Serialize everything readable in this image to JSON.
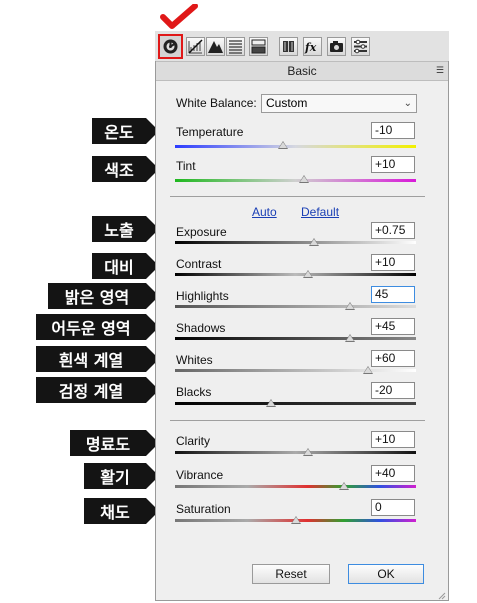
{
  "callouts": {
    "temperature": "온도",
    "tint": "색조",
    "exposure": "노출",
    "contrast": "대비",
    "highlights": "밝은 영역",
    "shadows": "어두운 영역",
    "whites": "흰색 계열",
    "blacks": "검정 계열",
    "clarity": "명료도",
    "vibrance": "활기",
    "saturation": "채도"
  },
  "toolbar": {
    "icons": [
      "basic-icon",
      "tone-curve-icon",
      "detail-icon",
      "hsl-icon",
      "split-toning-icon",
      "lens-corrections-icon",
      "effects-icon",
      "camera-calibration-icon",
      "presets-icon"
    ],
    "active_index": 0
  },
  "panel": {
    "title": "Basic",
    "white_balance_label": "White Balance:",
    "white_balance_value": "Custom",
    "auto_label": "Auto",
    "default_label": "Default"
  },
  "sliders": {
    "temperature": {
      "label": "Temperature",
      "value": "-10",
      "min": -100,
      "max": 100,
      "pos": -10
    },
    "tint": {
      "label": "Tint",
      "value": "+10",
      "min": -150,
      "max": 150,
      "pos": 10
    },
    "exposure": {
      "label": "Exposure",
      "value": "+0.75",
      "min": -5,
      "max": 5,
      "pos": 0.75
    },
    "contrast": {
      "label": "Contrast",
      "value": "+10",
      "min": -100,
      "max": 100,
      "pos": 10
    },
    "highlights": {
      "label": "Highlights",
      "value": "45",
      "min": -100,
      "max": 100,
      "pos": 45
    },
    "shadows": {
      "label": "Shadows",
      "value": "+45",
      "min": -100,
      "max": 100,
      "pos": 45
    },
    "whites": {
      "label": "Whites",
      "value": "+60",
      "min": -100,
      "max": 100,
      "pos": 60
    },
    "blacks": {
      "label": "Blacks",
      "value": "-20",
      "min": -100,
      "max": 100,
      "pos": -20
    },
    "clarity": {
      "label": "Clarity",
      "value": "+10",
      "min": -100,
      "max": 100,
      "pos": 10
    },
    "vibrance": {
      "label": "Vibrance",
      "value": "+40",
      "min": -100,
      "max": 100,
      "pos": 40
    },
    "saturation": {
      "label": "Saturation",
      "value": "0",
      "min": -100,
      "max": 100,
      "pos": 0
    }
  },
  "buttons": {
    "reset": "Reset",
    "ok": "OK"
  },
  "colors": {
    "accent_focus": "#3d8ce0",
    "check_mark": "#e01818",
    "link": "#1a3fb5"
  }
}
